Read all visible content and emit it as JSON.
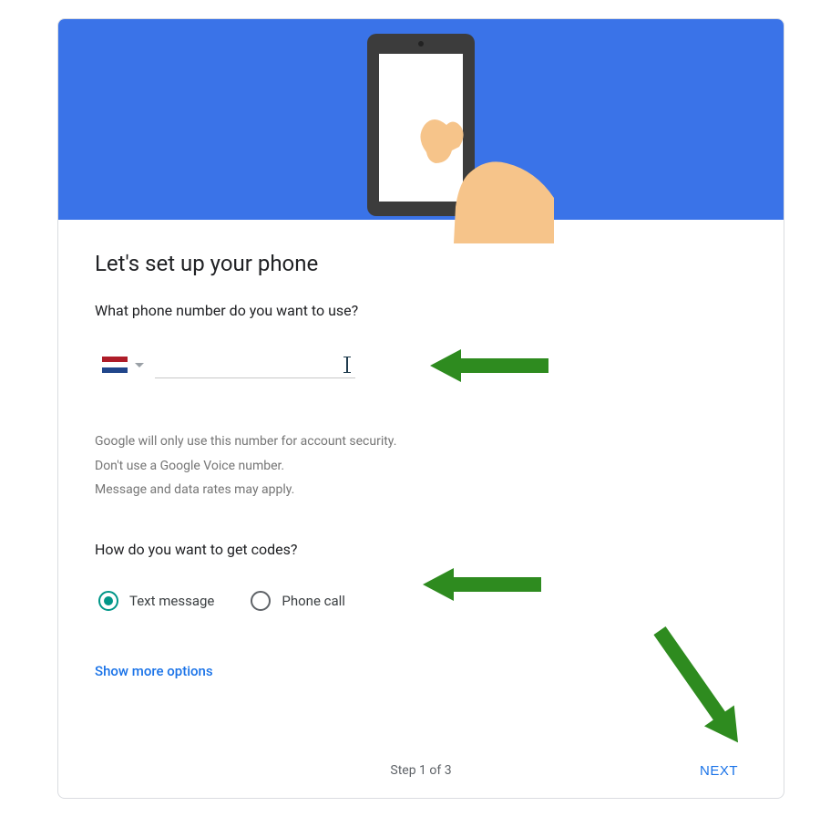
{
  "hero": {
    "illustration": "hand-holding-phone"
  },
  "title": "Let's set up your phone",
  "phone_section": {
    "question": "What phone number do you want to use?",
    "country_flag": "netherlands",
    "phone_value": "",
    "phone_placeholder": ""
  },
  "disclaimer": {
    "line1": "Google will only use this number for account security.",
    "line2": "Don't use a Google Voice number.",
    "line3": "Message and data rates may apply."
  },
  "codes_section": {
    "question": "How do you want to get codes?",
    "options": [
      {
        "id": "text",
        "label": "Text message",
        "selected": true
      },
      {
        "id": "call",
        "label": "Phone call",
        "selected": false
      }
    ]
  },
  "more_options_label": "Show more options",
  "footer": {
    "step_text": "Step 1 of 3",
    "next_label": "NEXT"
  },
  "colors": {
    "hero_bg": "#3a73e8",
    "accent_link": "#1a73e8",
    "radio_selected": "#009688",
    "annotation": "#2e8b1f"
  }
}
